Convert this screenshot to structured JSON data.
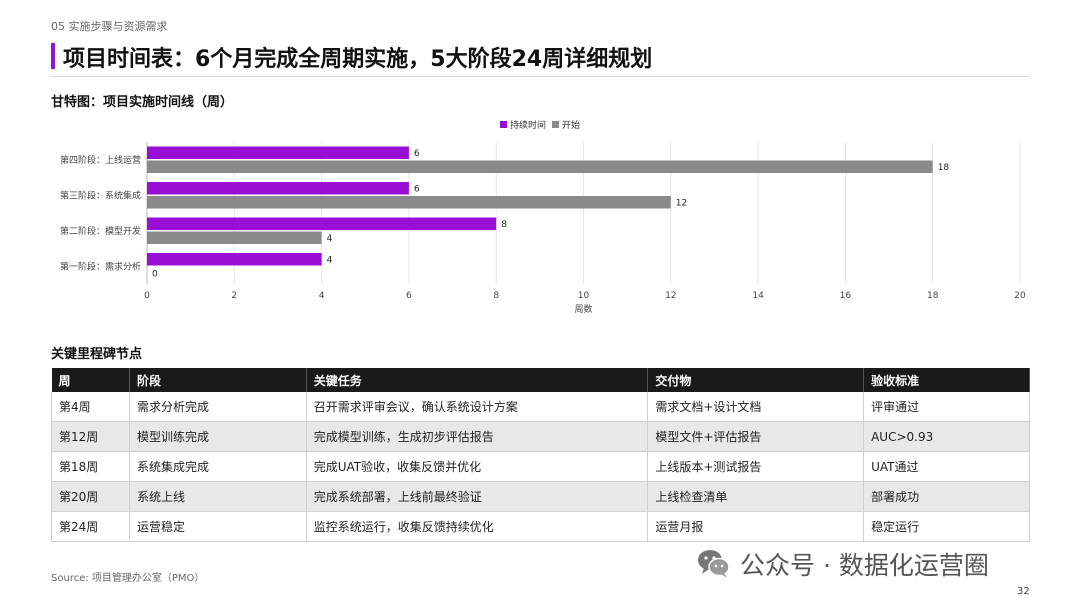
{
  "header": {
    "section_tag": "05 实施步骤与资源需求",
    "title": "项目时间表：6个月完成全周期实施，5大阶段24周详细规划"
  },
  "chart_heading": "甘特图：项目实施时间线（周）",
  "chart_data": {
    "type": "bar",
    "orientation": "horizontal",
    "categories": [
      "第四阶段：上线运营",
      "第三阶段：系统集成",
      "第二阶段：模型开发",
      "第一阶段：需求分析"
    ],
    "series": [
      {
        "name": "持续时间",
        "color": "#9a0fd6",
        "values": [
          6,
          6,
          8,
          4
        ]
      },
      {
        "name": "开始",
        "color": "#8a8a8d",
        "values": [
          18,
          12,
          4,
          0
        ]
      }
    ],
    "xlabel": "周数",
    "xlim": [
      0,
      20
    ],
    "xticks": [
      0,
      2,
      4,
      6,
      8,
      10,
      12,
      14,
      16,
      18,
      20
    ],
    "grid": true,
    "legend_position": "top-center"
  },
  "table_heading": "关键里程碑节点",
  "table": {
    "headers": [
      "周",
      "阶段",
      "关键任务",
      "交付物",
      "验收标准"
    ],
    "rows": [
      [
        "第4周",
        "需求分析完成",
        "召开需求评审会议，确认系统设计方案",
        "需求文档+设计文档",
        "评审通过"
      ],
      [
        "第12周",
        "模型训练完成",
        "完成模型训练，生成初步评估报告",
        "模型文件+评估报告",
        "AUC>0.93"
      ],
      [
        "第18周",
        "系统集成完成",
        "完成UAT验收，收集反馈并优化",
        "上线版本+测试报告",
        "UAT通过"
      ],
      [
        "第20周",
        "系统上线",
        "完成系统部署，上线前最终验证",
        "上线检查清单",
        "部署成功"
      ],
      [
        "第24周",
        "运营稳定",
        "监控系统运行，收集反馈持续优化",
        "运营月报",
        "稳定运行"
      ]
    ]
  },
  "source": "Source: 项目管理办公室（PMO）",
  "watermark": "公众号 · 数据化运营圈",
  "page_number": "32"
}
